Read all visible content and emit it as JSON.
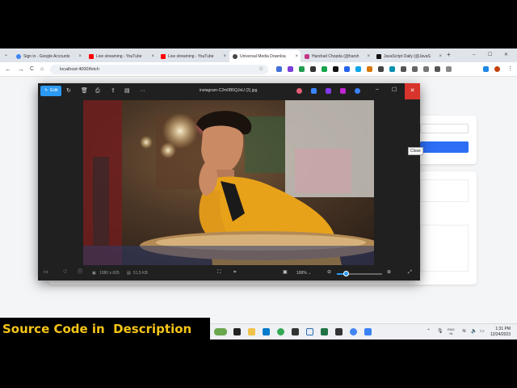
{
  "browser": {
    "tabs": [
      {
        "label": "Sign in - Google Accounts",
        "color": "#4285f4"
      },
      {
        "label": "Live streaming - YouTube",
        "color": "#ff0000"
      },
      {
        "label": "Live streaming - YouTube",
        "color": "#ff0000"
      },
      {
        "label": "Universal Media Downloa",
        "color": "#444444",
        "active": true
      },
      {
        "label": "Harshad Chopda (@harsh",
        "color": "#c13584"
      },
      {
        "label": "JavaScript Daily (@JavaS",
        "color": "#111111"
      }
    ],
    "new_tab": "+",
    "url": "localhost:4000/fetch",
    "back": "←",
    "forward": "→",
    "reload": "C",
    "home": "⌂"
  },
  "viewer": {
    "edit_label": "Edit",
    "title": "instagram-C2m0B5QJoU (2).jpg",
    "close_tooltip": "Close",
    "minimize": "–",
    "maximize": "☐",
    "close": "✕",
    "more": "···",
    "dimensions": "1080 x 605",
    "file_size": "51.5 KB",
    "zoom": "100%",
    "zoom_level": 0.2
  },
  "taskbar": {
    "lang_top": "ENG",
    "lang_bottom": "IN",
    "time": "1:31 PM",
    "date": "12/24/2023"
  },
  "banner": {
    "text": "Source Code in  Description",
    "color": "#f5c518"
  }
}
